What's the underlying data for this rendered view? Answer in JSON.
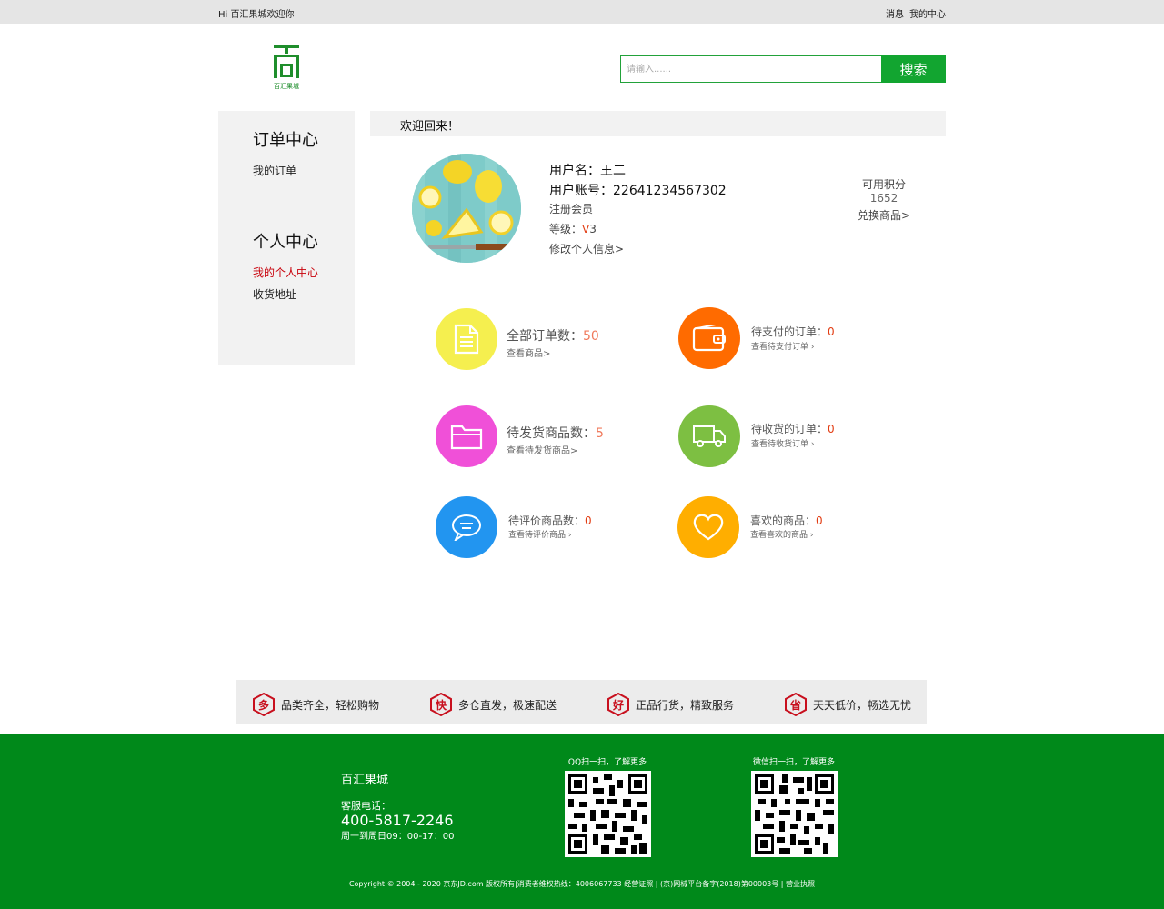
{
  "topbar": {
    "greeting": "Hi 百汇果城欢迎你",
    "messages": "消息",
    "my_center": "我的中心"
  },
  "logo": {
    "text": "百汇果城"
  },
  "search": {
    "placeholder": "请输入......",
    "button": "搜索"
  },
  "sidebar": {
    "order_head": "订单中心",
    "order_items": [
      "我的订单"
    ],
    "personal_head": "个人中心",
    "personal_items": [
      "我的个人中心",
      "收货地址"
    ],
    "active_item": "我的个人中心"
  },
  "welcome": "欢迎回来！",
  "user": {
    "name_label": "用户名：",
    "name": "王二",
    "account_label": "用户账号：",
    "account": "22641234567302",
    "member": "注册会员",
    "level_label": "等级：",
    "level_v": "V",
    "level_num": "3",
    "edit": "修改个人信息>"
  },
  "points": {
    "label": "可用积分",
    "value": "1652",
    "exchange": "兑换商品>"
  },
  "stats": {
    "all_orders": {
      "label": "全部订单数：",
      "count": "50",
      "link": "查看商品>",
      "color": "#f5ef4f",
      "icon": "document-icon"
    },
    "to_pay": {
      "label": "待支付的订单：",
      "count": "0",
      "link": "查看待支付订单",
      "color": "#ff6b00",
      "icon": "wallet-icon"
    },
    "to_ship": {
      "label": "待发货商品数：",
      "count": "5",
      "link": "查看待发货商品>",
      "color": "#f050d8",
      "icon": "folder-icon"
    },
    "to_receive": {
      "label": "待收货的订单：",
      "count": "0",
      "link": "查看待收货订单",
      "color": "#7dbf42",
      "icon": "truck-icon"
    },
    "to_review": {
      "label": "待评价商品数：",
      "count": "0",
      "link": "查看待评价商品",
      "color": "#2295f0",
      "icon": "chat-icon"
    },
    "favorites": {
      "label": "喜欢的商品：",
      "count": "0",
      "link": "查看喜欢的商品",
      "color": "#ffae00",
      "icon": "heart-icon"
    }
  },
  "features": [
    {
      "badge": "多",
      "text": "品类齐全，轻松购物"
    },
    {
      "badge": "快",
      "text": "多仓直发，极速配送"
    },
    {
      "badge": "好",
      "text": "正品行货，精致服务"
    },
    {
      "badge": "省",
      "text": "天天低价，畅选无忧"
    }
  ],
  "footer": {
    "brand": "百汇果城",
    "service_label": "客服电话：",
    "phone": "400-5817-2246",
    "hours": "周一到周日09：00-17：00",
    "qq_caption": "QQ扫一扫，了解更多",
    "wechat_caption": "微信扫一扫，了解更多",
    "copyright": "Copyright © 2004 - 2020 京东JD.com 版权所有|消费者维权热线：4006067733 经营证照 | (京)网械平台备字(2018)第00003号 | 营业执照"
  },
  "colors": {
    "brand_green": "#00891a",
    "search_green": "#12a530",
    "accent_red": "#c8000a"
  }
}
